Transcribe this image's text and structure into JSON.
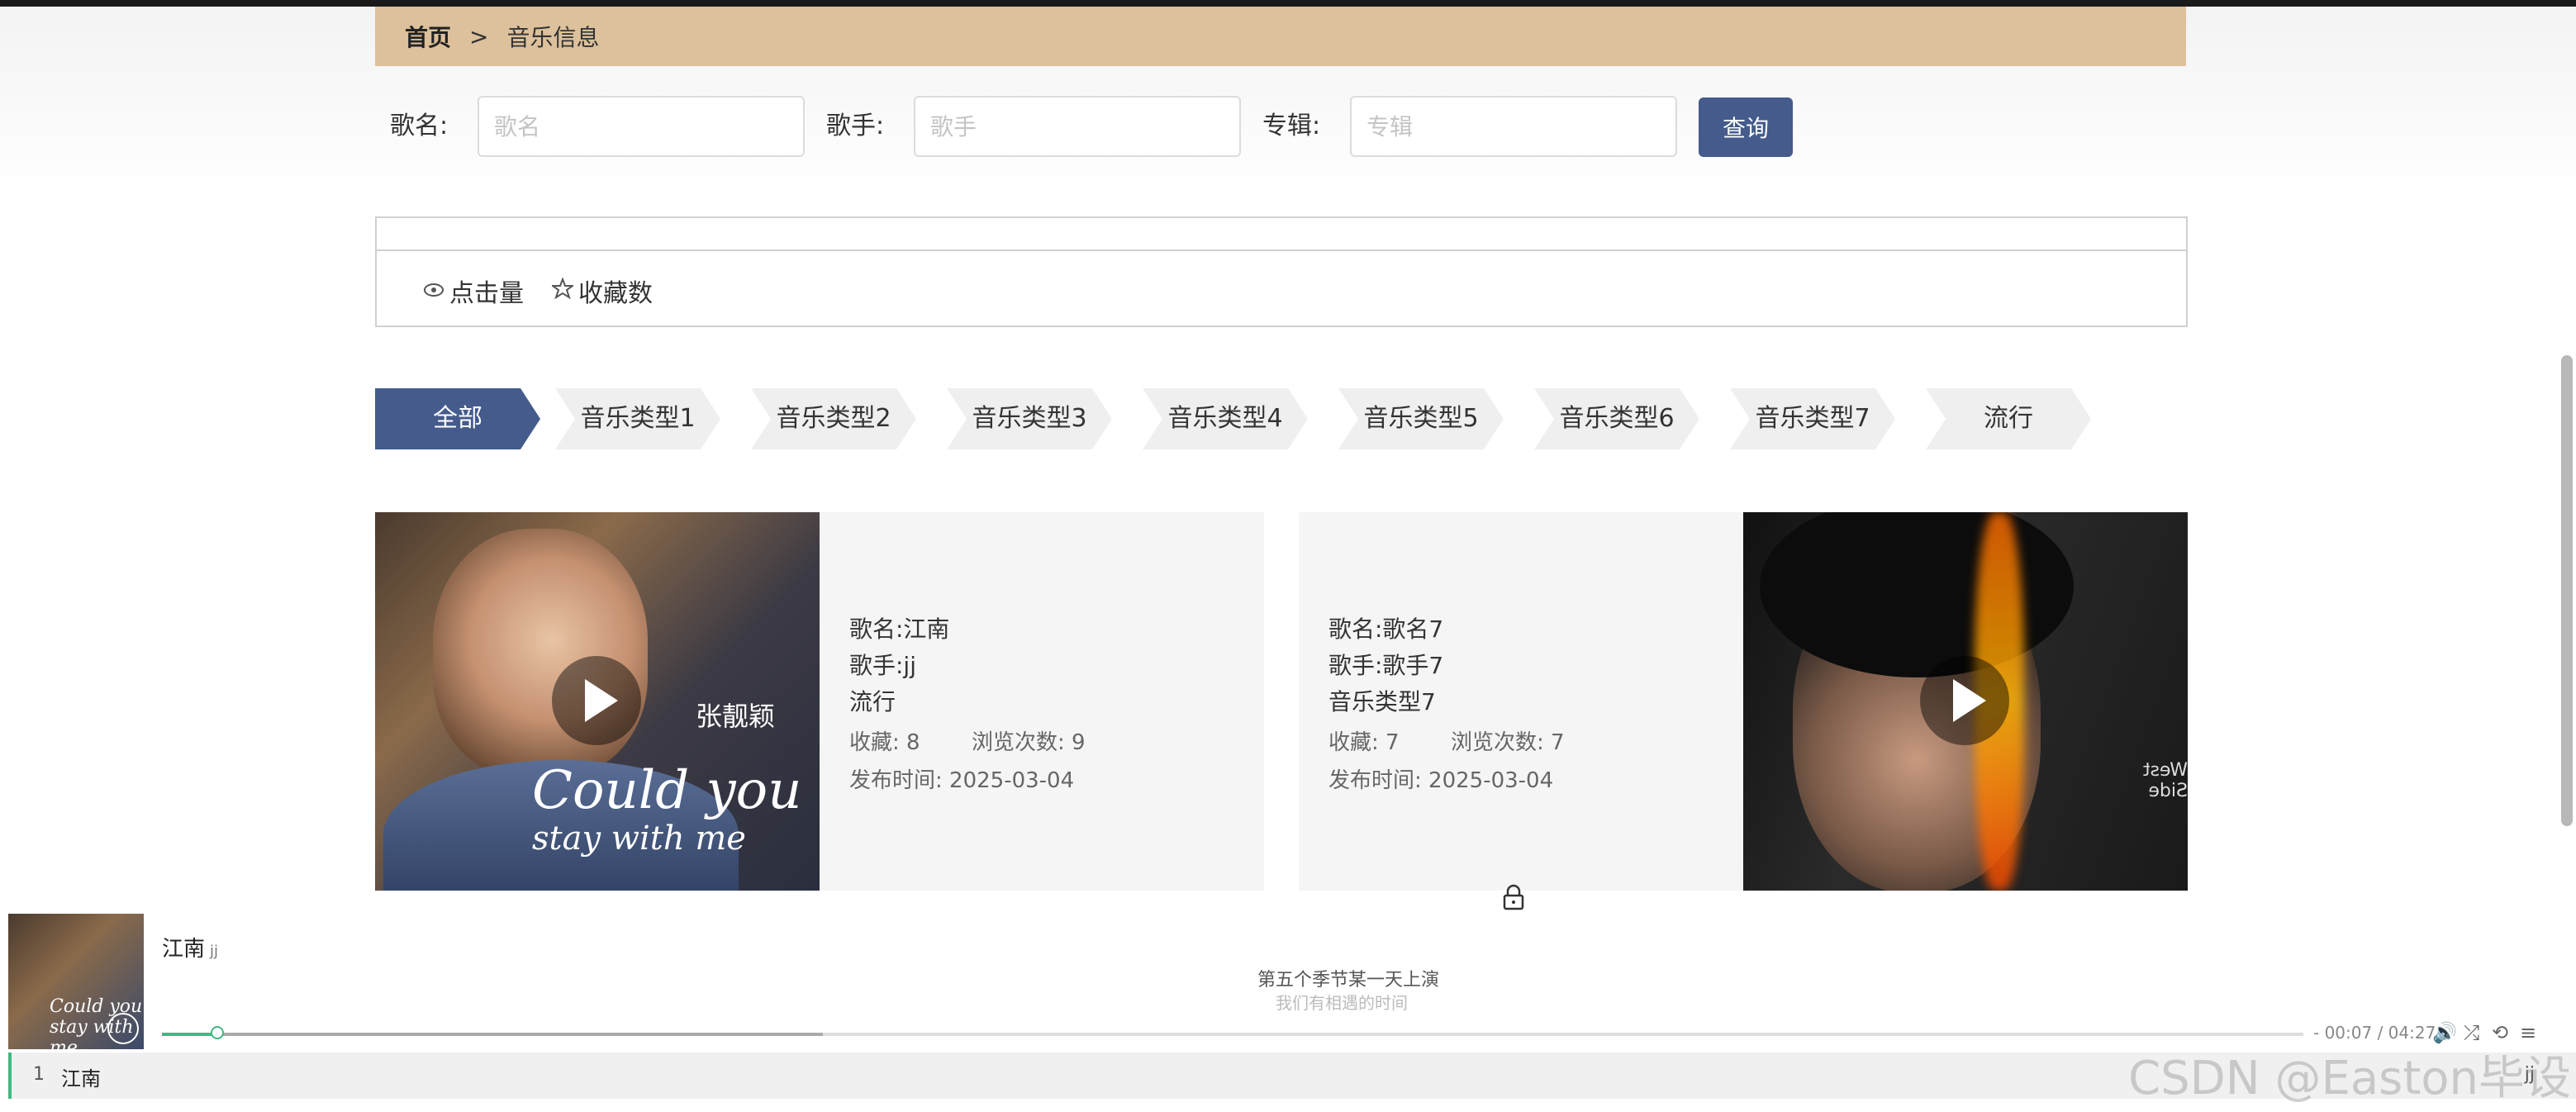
{
  "breadcrumb": {
    "home": "首页",
    "separator": ">",
    "current": "音乐信息"
  },
  "search": {
    "song_label": "歌名:",
    "song_placeholder": "歌名",
    "singer_label": "歌手:",
    "singer_placeholder": "歌手",
    "album_label": "专辑:",
    "album_placeholder": "专辑",
    "query_button": "查询"
  },
  "sort": {
    "clicks": "点击量",
    "favorites": "收藏数"
  },
  "categories": [
    "全部",
    "音乐类型1",
    "音乐类型2",
    "音乐类型3",
    "音乐类型4",
    "音乐类型5",
    "音乐类型6",
    "音乐类型7",
    "流行"
  ],
  "cards": [
    {
      "name": "歌名:江南",
      "singer": "歌手:jj",
      "type": "流行",
      "favorites": "收藏:  8",
      "views": "浏览次数:  9",
      "publish": "发布时间:  2025-03-04",
      "cover_text_cjk": "张靓颖",
      "cover_text_1": "Could you",
      "cover_text_2": "stay with me"
    },
    {
      "name": "歌名:歌名7",
      "singer": "歌手:歌手7",
      "type": "音乐类型7",
      "favorites": "收藏:  7",
      "views": "浏览次数:  7",
      "publish": "发布时间:  2025-03-04",
      "cover_side_text": "West Side"
    }
  ],
  "player": {
    "song": "江南",
    "artist": "jj",
    "lyric_current": "第五个季节某一天上演",
    "lyric_next": "我们有相遇的时间",
    "time": "- 00:07 / 04:27",
    "progress": 0.026,
    "playlist": [
      {
        "index": "1",
        "name": "江南",
        "artist": "jj"
      }
    ],
    "thumb_text": "Could you stay with me"
  },
  "watermark": "CSDN @Easton毕设",
  "colors": {
    "accent": "#445b8b",
    "breadcrumb_bg": "#dcc19c",
    "player_accent": "#41b883"
  }
}
